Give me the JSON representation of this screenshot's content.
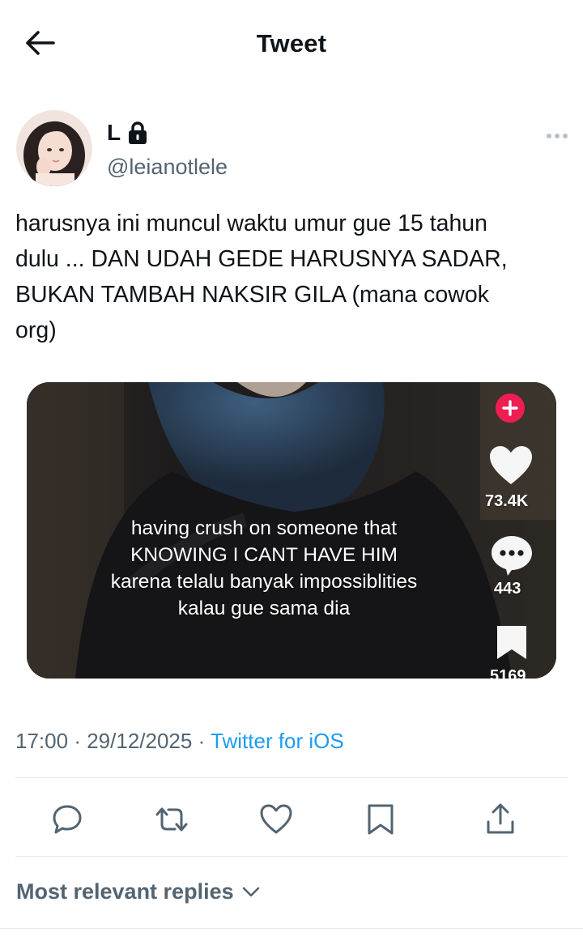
{
  "header": {
    "title": "Tweet"
  },
  "tweet": {
    "author": {
      "display_name": "L",
      "username": "@leianotlele",
      "protected": true
    },
    "text_lines": [
      "harusnya ini muncul waktu umur gue 15 tahun",
      "dulu ... DAN UDAH GEDE HARUSNYA SADAR,",
      "BUKAN TAMBAH NAKSIR GILA (mana cowok",
      "org)"
    ],
    "media": {
      "caption_lines": [
        "having crush on someone that",
        "KNOWING I CANT HAVE HIM",
        "karena telalu banyak impossiblities",
        "kalau gue sama dia"
      ],
      "likes": "73.4K",
      "comments": "443",
      "saves": "5169"
    },
    "time": "17:00",
    "date": "29/12/2025",
    "separator": "·",
    "source": "Twitter for iOS"
  },
  "actions": [
    "reply",
    "retweet",
    "like",
    "bookmark",
    "share"
  ],
  "replies": {
    "sort_label": "Most relevant replies"
  },
  "colors": {
    "accent": "#1d9bf0",
    "text": "#0f1419",
    "muted": "#536471",
    "divider": "#e6e8ea"
  }
}
